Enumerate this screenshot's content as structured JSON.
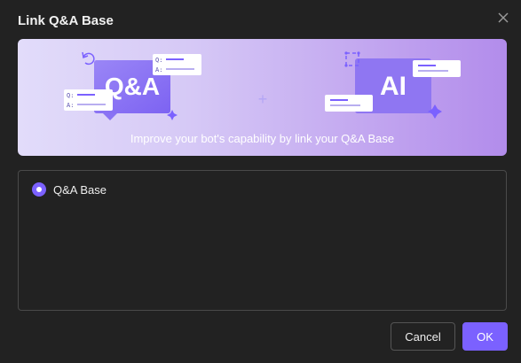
{
  "dialog": {
    "title": "Link Q&A Base",
    "close_icon": "close-icon"
  },
  "banner": {
    "qa_label": "Q&A",
    "ai_label": "AI",
    "q_prefix": "Q:",
    "a_prefix": "A:",
    "plus_symbol": "+",
    "caption": "Improve your bot's capability by link your Q&A Base"
  },
  "options": [
    {
      "label": "Q&A Base",
      "selected": true
    }
  ],
  "buttons": {
    "cancel_label": "Cancel",
    "ok_label": "OK"
  },
  "colors": {
    "accent": "#7b61ff",
    "background": "#222222"
  }
}
